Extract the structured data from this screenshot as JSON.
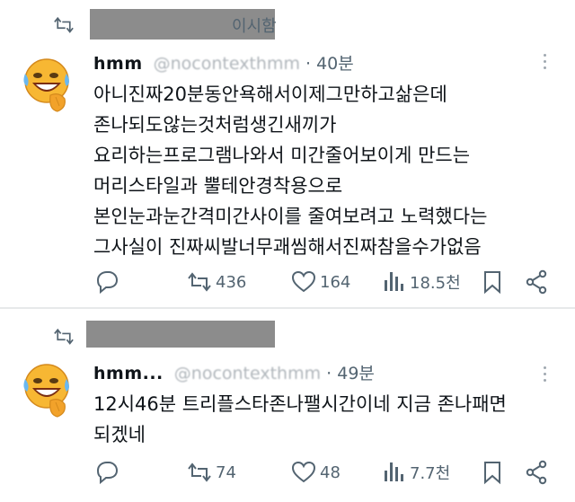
{
  "tweets": [
    {
      "repost_label": "이시함",
      "name": "hmm",
      "handle": "@nocontexthmm",
      "separator": " · ",
      "time": "40분",
      "lines": [
        "아니진짜20분동안욕해서이제그만하고삶은데",
        "존나되도않는것처럼생긴새끼가",
        "요리하는프로그램나와서  미간줄어보이게 만드는",
        "머리스타일과  뿔테안경착용으로",
        "본인눈과눈간격미간사이를 줄여보려고 노력했다는",
        "그사실이 진짜씨발너무괘씸해서진짜참을수가없음"
      ],
      "retweets": "436",
      "likes": "164",
      "views": "18.5천"
    },
    {
      "repost_label": "",
      "name": "hmm...",
      "handle": "@nocontexthmm",
      "separator": " · ",
      "time": "49분",
      "lines": [
        "12시46분 트리플스타존나팰시간이네  지금 존나패면",
        "되겠네"
      ],
      "retweets": "74",
      "likes": "48",
      "views": "7.7천"
    }
  ],
  "colors": {
    "text": "#0f1419",
    "secondary": "#536471",
    "redaction": "#8c8c8c",
    "divider": "#e7e9ea"
  },
  "icons": [
    "repost-icon",
    "avatar-emoji",
    "more-icon",
    "reply-icon",
    "retweet-icon",
    "like-icon",
    "views-icon",
    "bookmark-icon",
    "share-icon"
  ]
}
